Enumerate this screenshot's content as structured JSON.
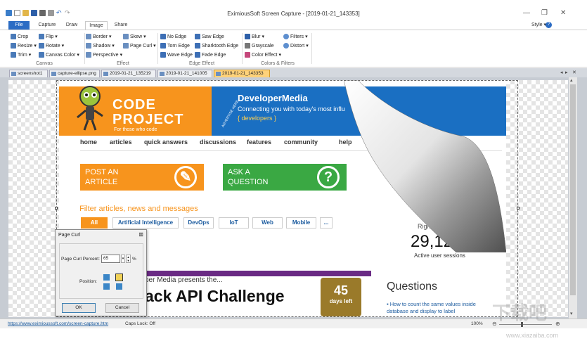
{
  "window": {
    "title": "EximiousSoft Screen Capture - [2019-01-21_143353]",
    "minimize": "—",
    "restore": "❐",
    "close": "✕"
  },
  "ribbon_tabs": [
    "File",
    "Capture",
    "Draw",
    "Image",
    "Share"
  ],
  "style_menu": "Style",
  "ribbon": {
    "canvas": {
      "label": "Canvas",
      "crop": "Crop",
      "resize": "Resize",
      "trim": "Trim",
      "flip": "Flip",
      "rotate": "Rotate",
      "canvas_color": "Canvas Color"
    },
    "effect": {
      "label": "Effect",
      "border": "Border",
      "shadow": "Shadow",
      "perspective": "Perspective",
      "skew": "Skew",
      "page_curl": "Page Curl"
    },
    "edge": {
      "label": "Edge Effect",
      "no_edge": "No Edge",
      "torn_edge": "Torn Edge",
      "wave_edge": "Wave Edge",
      "saw_edge": "Saw Edge",
      "sharktooth_edge": "Sharktooth Edge",
      "fade_edge": "Fade Edge"
    },
    "colors": {
      "label": "Colors & Filters",
      "blur": "Blur",
      "grayscale": "Grayscale",
      "color_effect": "Color Effect",
      "filters": "Filters",
      "distort": "Distort"
    }
  },
  "doc_tabs": [
    "screenshot1",
    "capture-ellipse.png",
    "2019-01-21_135219",
    "2019-01-21_141005",
    "2019-01-21_143353"
  ],
  "webpage": {
    "logo_line1": "CODE",
    "logo_line2": "PROJECT",
    "tagline": "For those who code",
    "ad_brand": "DeveloperMedia",
    "ad_text": "Connecting you with today's most influ",
    "ad_dev": "{ developers }",
    "advertise": "ADVERTISE HERE",
    "nav": [
      "home",
      "articles",
      "quick answers",
      "discussions",
      "features",
      "community",
      "help"
    ],
    "cta1": "POST AN ARTICLE",
    "cta2": "ASK A QUESTION",
    "filter_title": "Filter articles, news and messages",
    "filters": [
      "All",
      "Artificial Intelligence",
      "DevOps",
      "IoT",
      "Web",
      "Mobile",
      "..."
    ],
    "right_now": "Right Now",
    "active_count": "29,126",
    "active_label": "Active user sessions",
    "promo_line": "per Media presents the...",
    "promo_big": "ack API Challenge",
    "days": "45",
    "days_label": "days left",
    "questions": "Questions",
    "q1": "How to count the same values inside database and display to label"
  },
  "dialog": {
    "title": "Page Curl",
    "percent_label": "Page Curl Percent:",
    "percent_value": "65",
    "percent_unit": "%",
    "position_label": "Position:",
    "ok": "OK",
    "cancel": "Cancel"
  },
  "status": {
    "url": "https://www.eximioussoft.com/screen-capture.htm",
    "caps": "Caps Lock: Off",
    "zoom": "100%"
  },
  "watermark": "下载吧",
  "watermark_url": "www.xiazaiba.com"
}
